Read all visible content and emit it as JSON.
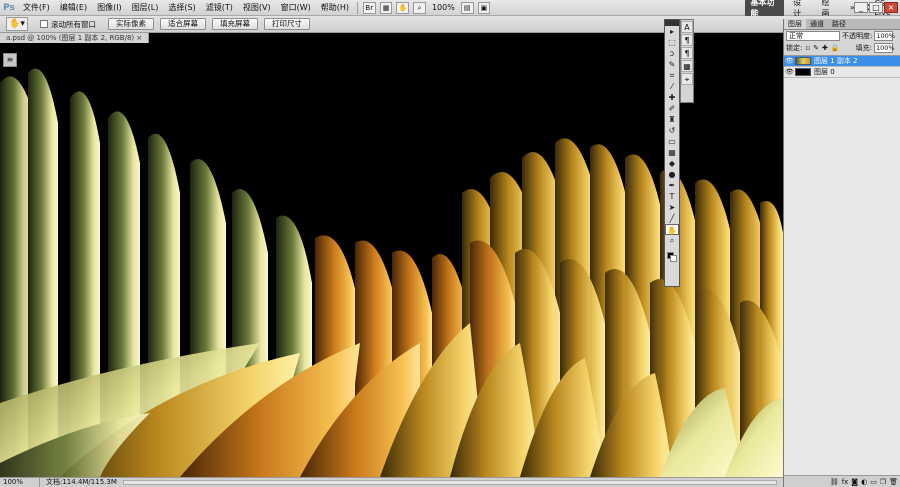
{
  "app": {
    "logo": "Ps",
    "menus": [
      "文件(F)",
      "编辑(E)",
      "图像(I)",
      "图层(L)",
      "选择(S)",
      "滤镜(T)",
      "视图(V)",
      "窗口(W)",
      "帮助(H)"
    ],
    "zoom": "100%",
    "workspaces": [
      "基本功能",
      "设计",
      "绘画"
    ],
    "more": "»",
    "cs_live": "CS Live",
    "window_buttons": [
      "_",
      "□",
      "×"
    ]
  },
  "options": {
    "scroll_all_label": "滚动所有窗口",
    "buttons": [
      "实际像素",
      "适合屏幕",
      "填充屏幕",
      "打印尺寸"
    ]
  },
  "document": {
    "tab_title": "a.psd @ 100% (图层 1 副本 2, RGB/8) ×"
  },
  "status": {
    "zoom": "100%",
    "doc_info": "文档:114.4M/115.3M"
  },
  "layers_panel": {
    "tabs": [
      "图层",
      "通道",
      "路径"
    ],
    "blend_mode": "正常",
    "opacity_label": "不透明度:",
    "opacity_value": "100%",
    "lock_label": "锁定:",
    "fill_label": "填充:",
    "fill_value": "100%",
    "layers": [
      {
        "name": "图层 1 副本 2",
        "selected": true
      },
      {
        "name": "图层 0",
        "selected": false
      }
    ],
    "footer_icons": [
      "link-icon",
      "fx-icon",
      "mask-icon",
      "adjustment-icon",
      "folder-icon",
      "new-layer-icon",
      "trash-icon"
    ]
  },
  "tools": [
    "move",
    "marquee",
    "lasso",
    "quick-select",
    "crop",
    "eyedropper",
    "healing",
    "brush",
    "clone-stamp",
    "history-brush",
    "eraser",
    "gradient",
    "blur",
    "dodge",
    "pen",
    "type",
    "path-select",
    "shape",
    "hand",
    "zoom"
  ],
  "colors": {
    "selection": "#3d8ee8",
    "canvas": "#000000"
  }
}
